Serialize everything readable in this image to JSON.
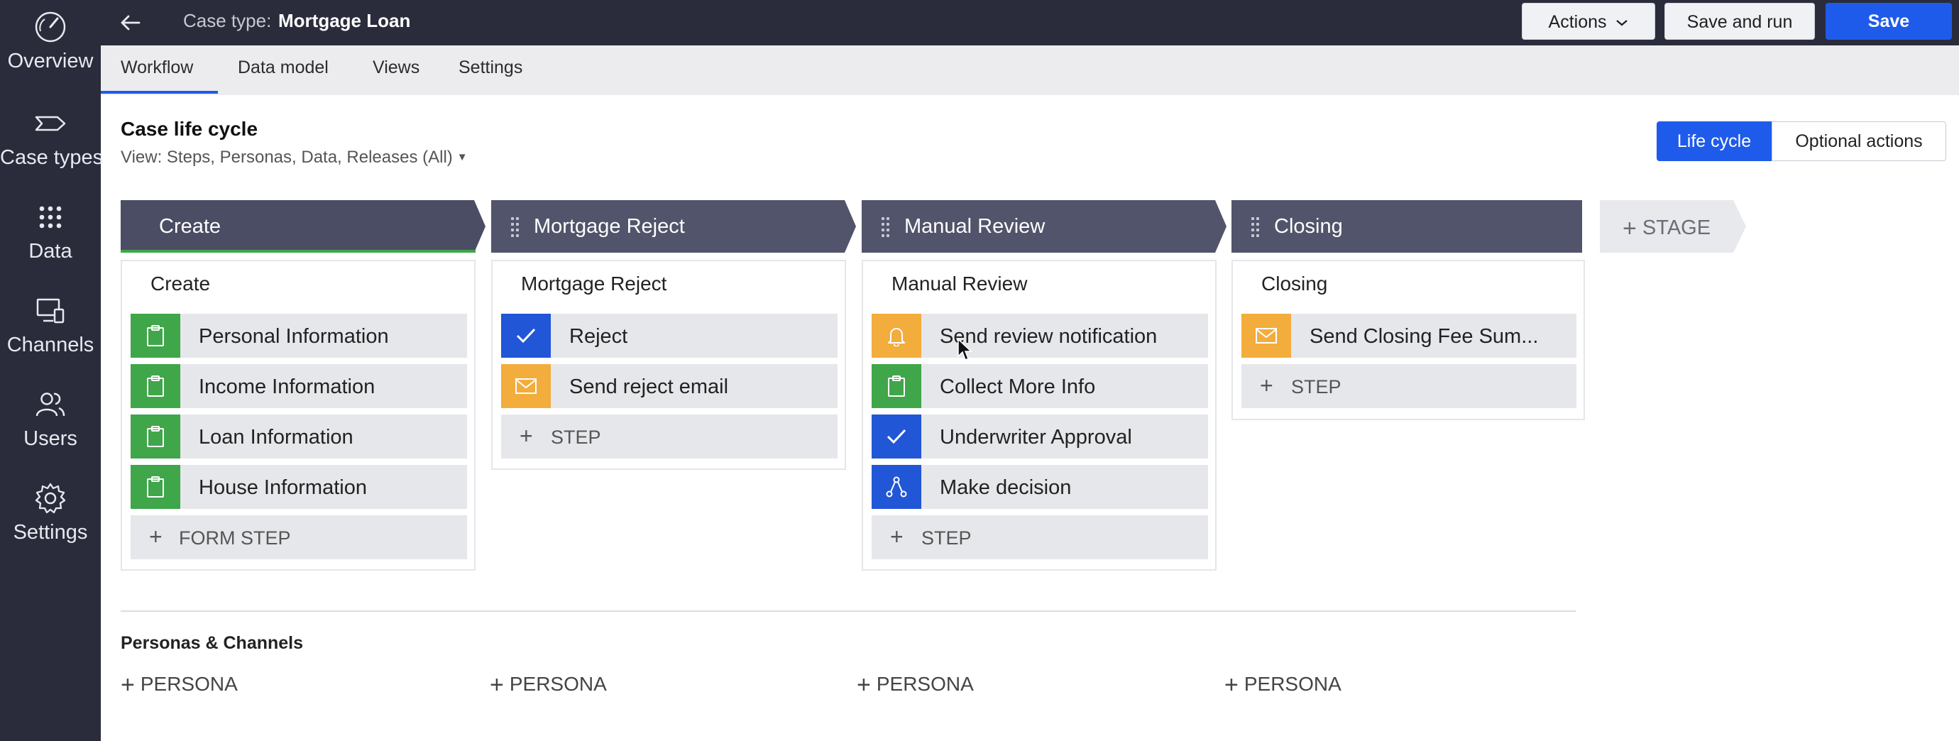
{
  "sidebar": {
    "items": [
      {
        "label": "Overview",
        "icon": "overview-icon"
      },
      {
        "label": "Case types",
        "icon": "case-types-icon"
      },
      {
        "label": "Data",
        "icon": "data-icon"
      },
      {
        "label": "Channels",
        "icon": "channels-icon"
      },
      {
        "label": "Users",
        "icon": "users-icon"
      },
      {
        "label": "Settings",
        "icon": "gear-icon"
      }
    ]
  },
  "header": {
    "case_type_label": "Case type:",
    "case_type_name": "Mortgage Loan",
    "actions_label": "Actions",
    "save_and_run_label": "Save and run",
    "save_label": "Save"
  },
  "tabs": [
    "Workflow",
    "Data model",
    "Views",
    "Settings"
  ],
  "lifecycle": {
    "title": "Case life cycle",
    "view_selector": "View: Steps, Personas, Data, Releases (All)",
    "toggle_on": "Life cycle",
    "toggle_off": "Optional actions"
  },
  "stages": [
    {
      "name": "Create",
      "process": "Create",
      "steps": [
        {
          "label": "Personal Information",
          "icon": "clipboard-icon",
          "color": "#3fa64a"
        },
        {
          "label": "Income Information",
          "icon": "clipboard-icon",
          "color": "#3fa64a"
        },
        {
          "label": "Loan Information",
          "icon": "clipboard-icon",
          "color": "#3fa64a"
        },
        {
          "label": "House Information",
          "icon": "clipboard-icon",
          "color": "#3fa64a"
        }
      ],
      "add_label": "FORM STEP"
    },
    {
      "name": "Mortgage Reject",
      "process": "Mortgage Reject",
      "steps": [
        {
          "label": "Reject",
          "icon": "check-icon",
          "color": "#2156d6"
        },
        {
          "label": "Send reject email",
          "icon": "envelope-icon",
          "color": "#f3ad3d"
        }
      ],
      "add_label": "STEP"
    },
    {
      "name": "Manual Review",
      "process": "Manual Review",
      "steps": [
        {
          "label": "Send review notification",
          "icon": "bell-icon",
          "color": "#f3ad3d"
        },
        {
          "label": "Collect More Info",
          "icon": "clipboard-icon",
          "color": "#3fa64a"
        },
        {
          "label": "Underwriter Approval",
          "icon": "check-icon",
          "color": "#2156d6"
        },
        {
          "label": "Make decision",
          "icon": "decision-icon",
          "color": "#2156d6"
        }
      ],
      "add_label": "STEP"
    },
    {
      "name": "Closing",
      "process": "Closing",
      "steps": [
        {
          "label": "Send Closing Fee Sum...",
          "icon": "envelope-icon",
          "color": "#f3ad3d"
        }
      ],
      "add_label": "STEP"
    }
  ],
  "add_stage_label": "STAGE",
  "personas_channels": {
    "title": "Personas & Channels",
    "add_persona_label": "PERSONA"
  },
  "colors": {
    "accent": "#1f5bea",
    "sidebar": "#2a2c3b",
    "stage_header": "#51546a",
    "first_stage_header": "#4a4d63",
    "form_step": "#3fa64a",
    "approval_step": "#2156d6",
    "notify_step": "#f3ad3d"
  }
}
